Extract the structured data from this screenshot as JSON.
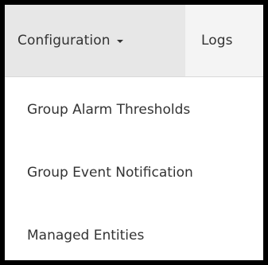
{
  "nav": {
    "configuration": {
      "label": "Configuration",
      "icon": "caret-down-icon"
    },
    "logs": {
      "label": "Logs"
    }
  },
  "dropdown": {
    "items": [
      {
        "label": "Group Alarm Thresholds"
      },
      {
        "label": "Group Event Notification"
      },
      {
        "label": "Managed Entities"
      }
    ]
  },
  "colors": {
    "frame_border": "#000000",
    "nav_background": "#f2f2f2",
    "active_tab_background": "#e7e7e7",
    "text": "#333333",
    "menu_background": "#ffffff"
  }
}
